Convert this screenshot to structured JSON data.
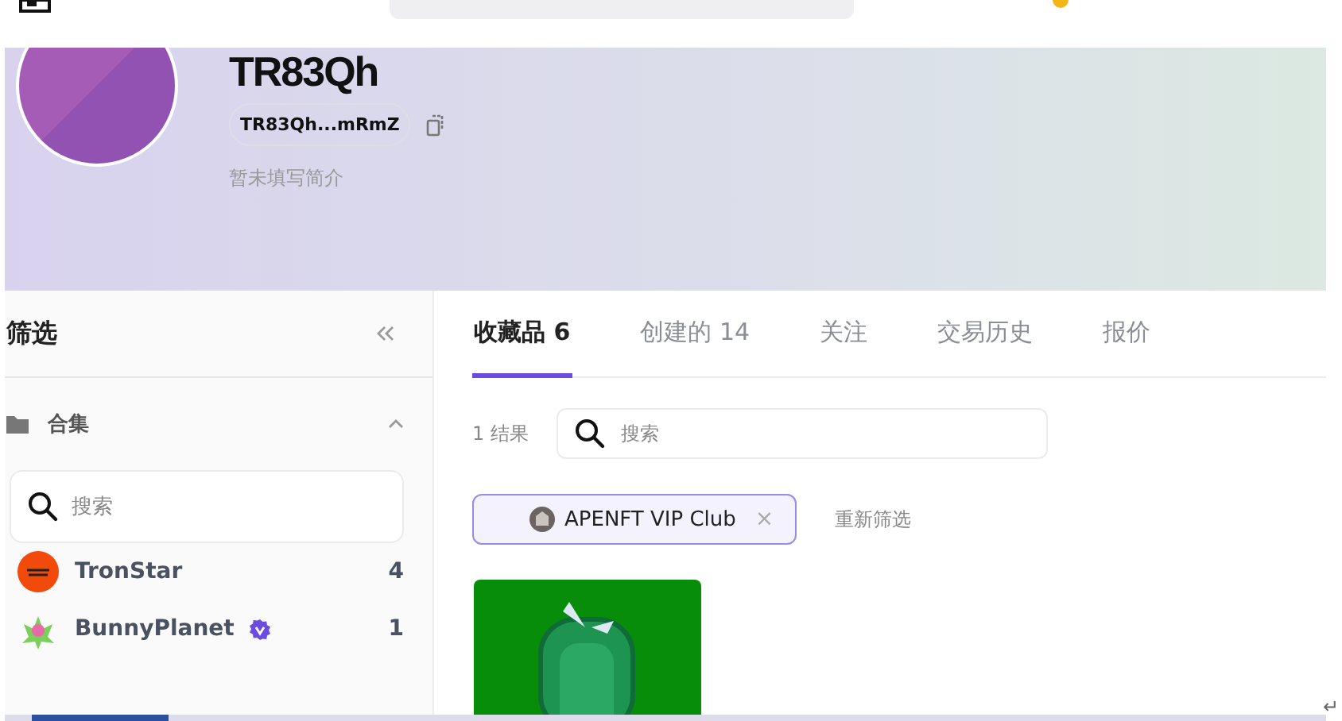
{
  "profile": {
    "name": "TR83Qh",
    "address": "TR83Qh...mRmZ",
    "bio": "暂未填写简介"
  },
  "sidebar": {
    "title": "筛选",
    "section": {
      "label": "合集",
      "expanded": true
    },
    "search": {
      "placeholder": "搜索"
    },
    "collections": [
      {
        "name": "TronStar",
        "count": "4",
        "verified": false
      },
      {
        "name": "BunnyPlanet",
        "count": "1",
        "verified": true
      }
    ]
  },
  "tabs": [
    {
      "label": "收藏品 6",
      "selected": true
    },
    {
      "label": "创建的 14",
      "selected": false
    },
    {
      "label": "关注",
      "selected": false
    },
    {
      "label": "交易历史",
      "selected": false
    },
    {
      "label": "报价",
      "selected": false
    }
  ],
  "results": {
    "count": "1 结果",
    "search": {
      "placeholder": "搜索"
    }
  },
  "filters": [
    {
      "label": "APENFT VIP Club",
      "remove": "×"
    }
  ],
  "reset": "重新筛选",
  "corner_mark": "↵"
}
